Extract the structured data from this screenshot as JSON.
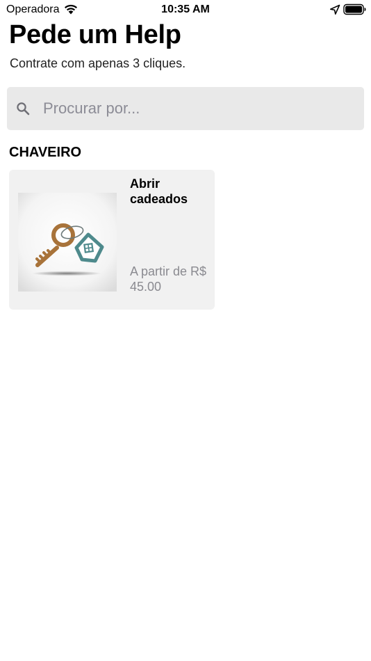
{
  "status_bar": {
    "carrier": "Operadora",
    "time": "10:35 AM"
  },
  "header": {
    "title": "Pede um Help",
    "subtitle": "Contrate com apenas 3 cliques."
  },
  "search": {
    "placeholder": "Procurar por..."
  },
  "section": {
    "title": "CHAVEIRO"
  },
  "services": [
    {
      "title": "Abrir cadeados",
      "price": "A partir de R$ 45.00",
      "image_icon": "key-with-house-keychain-icon"
    }
  ],
  "colors": {
    "search_background": "#e9e9e9",
    "card_background": "#f1f1f1",
    "placeholder": "#8c8c96",
    "price_text": "#8a8a90",
    "key_brown": "#a8733a",
    "house_teal": "#4e8a8c"
  }
}
